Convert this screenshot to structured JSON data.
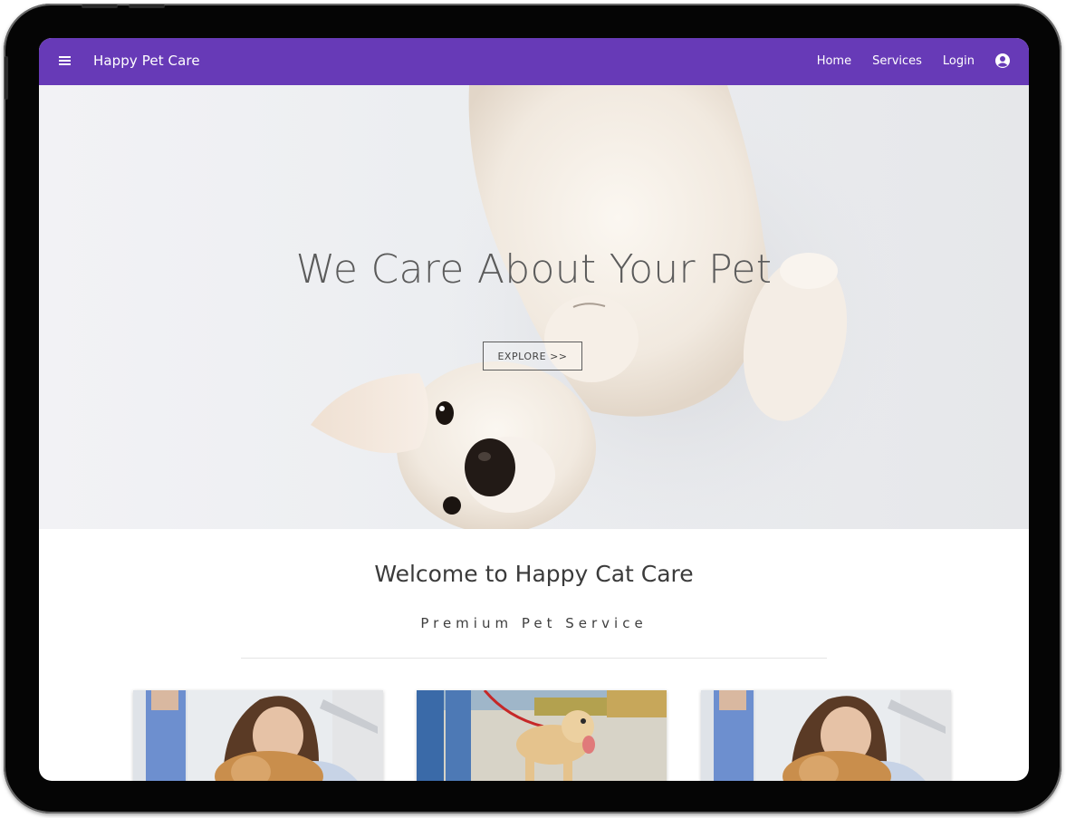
{
  "app": {
    "brand": "Happy Pet Care",
    "colors": {
      "primary": "#673ab7",
      "text_on_primary": "#ffffff"
    }
  },
  "nav": {
    "menu_icon": "hamburger-menu-icon",
    "links": [
      {
        "label": "Home"
      },
      {
        "label": "Services"
      },
      {
        "label": "Login"
      }
    ],
    "account_icon": "account-circle-icon"
  },
  "hero": {
    "title": "We Care About Your Pet",
    "button_label": "EXPLORE >>",
    "image": "puppy-lying-on-back"
  },
  "welcome": {
    "title": "Welcome to Happy Cat Care",
    "subtitle": "Premium Pet Service"
  },
  "cards": [
    {
      "image": "woman-hugging-dog-at-vet"
    },
    {
      "image": "person-walking-dog-on-leash"
    },
    {
      "image": "woman-hugging-dog-at-vet"
    }
  ]
}
